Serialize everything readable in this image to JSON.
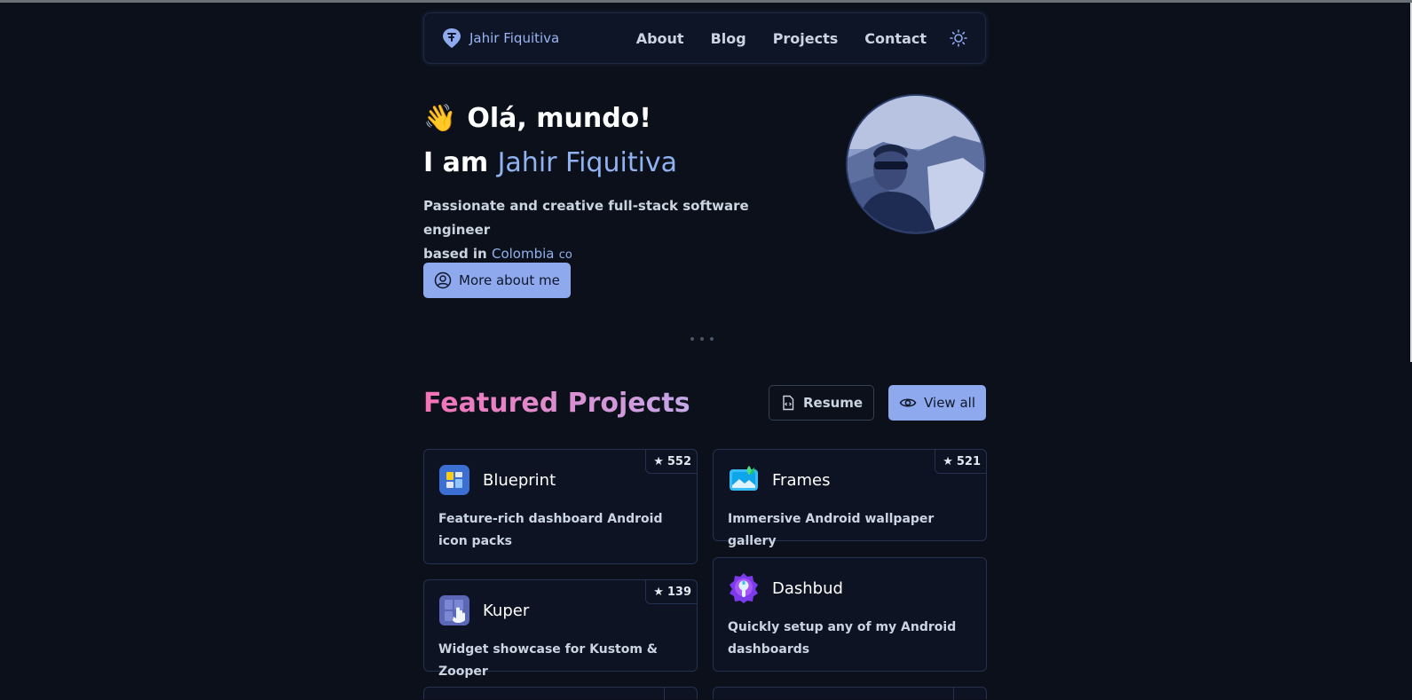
{
  "nav": {
    "brand_name": "Jahir Fiquitiva",
    "links": [
      "About",
      "Blog",
      "Projects",
      "Contact"
    ]
  },
  "hero": {
    "greeting_emoji": "👋",
    "greeting": "Olá, mundo!",
    "intro_prefix": "I am",
    "name": "Jahir Fiquitiva",
    "tagline_line1": "Passionate and creative full-stack software engineer",
    "tagline_line2": "based in",
    "country": "Colombia",
    "country_code": "co",
    "more_button": "More about me"
  },
  "projects": {
    "title": "Featured Projects",
    "resume_button": "Resume",
    "view_all_button": "View all",
    "items": [
      {
        "name": "Blueprint",
        "description": "Feature-rich dashboard Android icon packs",
        "stars": "552"
      },
      {
        "name": "Frames",
        "description": "Immersive Android wallpaper gallery",
        "stars": "521"
      },
      {
        "name": "Kuper",
        "description": "Widget showcase for Kustom & Zooper",
        "stars": "139"
      },
      {
        "name": "Dashbud",
        "description": "Quickly setup any of my Android dashboards"
      }
    ]
  },
  "colors": {
    "background": "#0b101b",
    "accent": "#8fa9ee",
    "highlight_text": "#90b2f0",
    "title_gradient_start": "#f472b6",
    "title_gradient_end": "#c4a8e8"
  }
}
